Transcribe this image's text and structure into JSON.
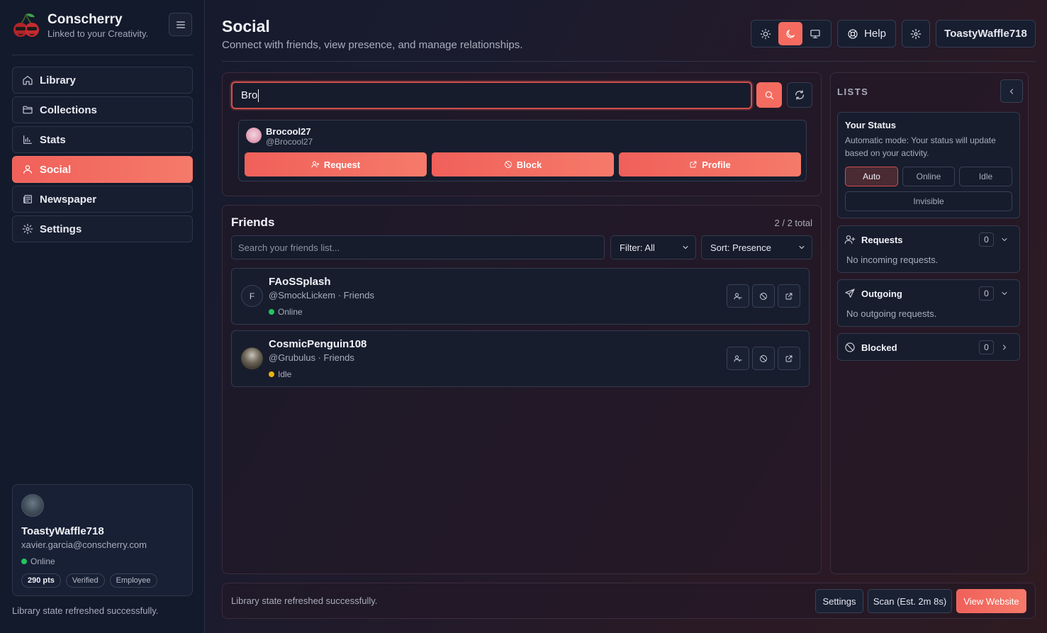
{
  "brand": {
    "name": "Conscherry",
    "tagline": "Linked to your Creativity."
  },
  "sidebar": {
    "items": [
      {
        "label": "Library",
        "icon": "home-icon"
      },
      {
        "label": "Collections",
        "icon": "folder-icon"
      },
      {
        "label": "Stats",
        "icon": "bar-chart-icon"
      },
      {
        "label": "Social",
        "icon": "user-icon",
        "active": true
      },
      {
        "label": "Newspaper",
        "icon": "newspaper-icon"
      },
      {
        "label": "Settings",
        "icon": "gear-icon"
      }
    ],
    "user": {
      "name": "ToastyWaffle718",
      "email": "xavier.garcia@conscherry.com",
      "status": "Online",
      "badges": [
        "290 pts",
        "Verified",
        "Employee"
      ]
    },
    "status_message": "Library state refreshed successfully."
  },
  "header": {
    "title": "Social",
    "subtitle": "Connect with friends, view presence, and manage relationships.",
    "help_label": "Help",
    "user_label": "ToastyWaffle718",
    "theme_active": "dark"
  },
  "search": {
    "value": "Bro",
    "result": {
      "name": "Brocool27",
      "handle": "@Brocool27",
      "actions": [
        "Request",
        "Block",
        "Profile"
      ]
    }
  },
  "friends": {
    "title": "Friends",
    "count": "2 / 2 total",
    "search_placeholder": "Search your friends list...",
    "filter_label": "Filter: All",
    "sort_label": "Sort: Presence",
    "list": [
      {
        "initial": "F",
        "name": "FAoSSplash",
        "sub": "@SmockLickem · Friends",
        "status": "Online",
        "status_color": "#22c55e"
      },
      {
        "initial": "",
        "name": "CosmicPenguin108",
        "sub": "@Grubulus · Friends",
        "status": "Idle",
        "status_color": "#eab308"
      }
    ]
  },
  "lists": {
    "title": "LISTS",
    "your_status": {
      "title": "Your Status",
      "description": "Automatic mode: Your status will update based on your activity.",
      "options": [
        "Auto",
        "Online",
        "Idle",
        "Invisible"
      ],
      "selected": "Auto"
    },
    "requests": {
      "label": "Requests",
      "count": "0",
      "empty": "No incoming requests."
    },
    "outgoing": {
      "label": "Outgoing",
      "count": "0",
      "empty": "No outgoing requests."
    },
    "blocked": {
      "label": "Blocked",
      "count": "0"
    }
  },
  "footer": {
    "message": "Library state refreshed successfully.",
    "settings_label": "Settings",
    "scan_label": "Scan (Est. 2m 8s)",
    "website_label": "View Website"
  },
  "colors": {
    "accent": "#f56b60",
    "online": "#22c55e",
    "idle": "#eab308"
  }
}
